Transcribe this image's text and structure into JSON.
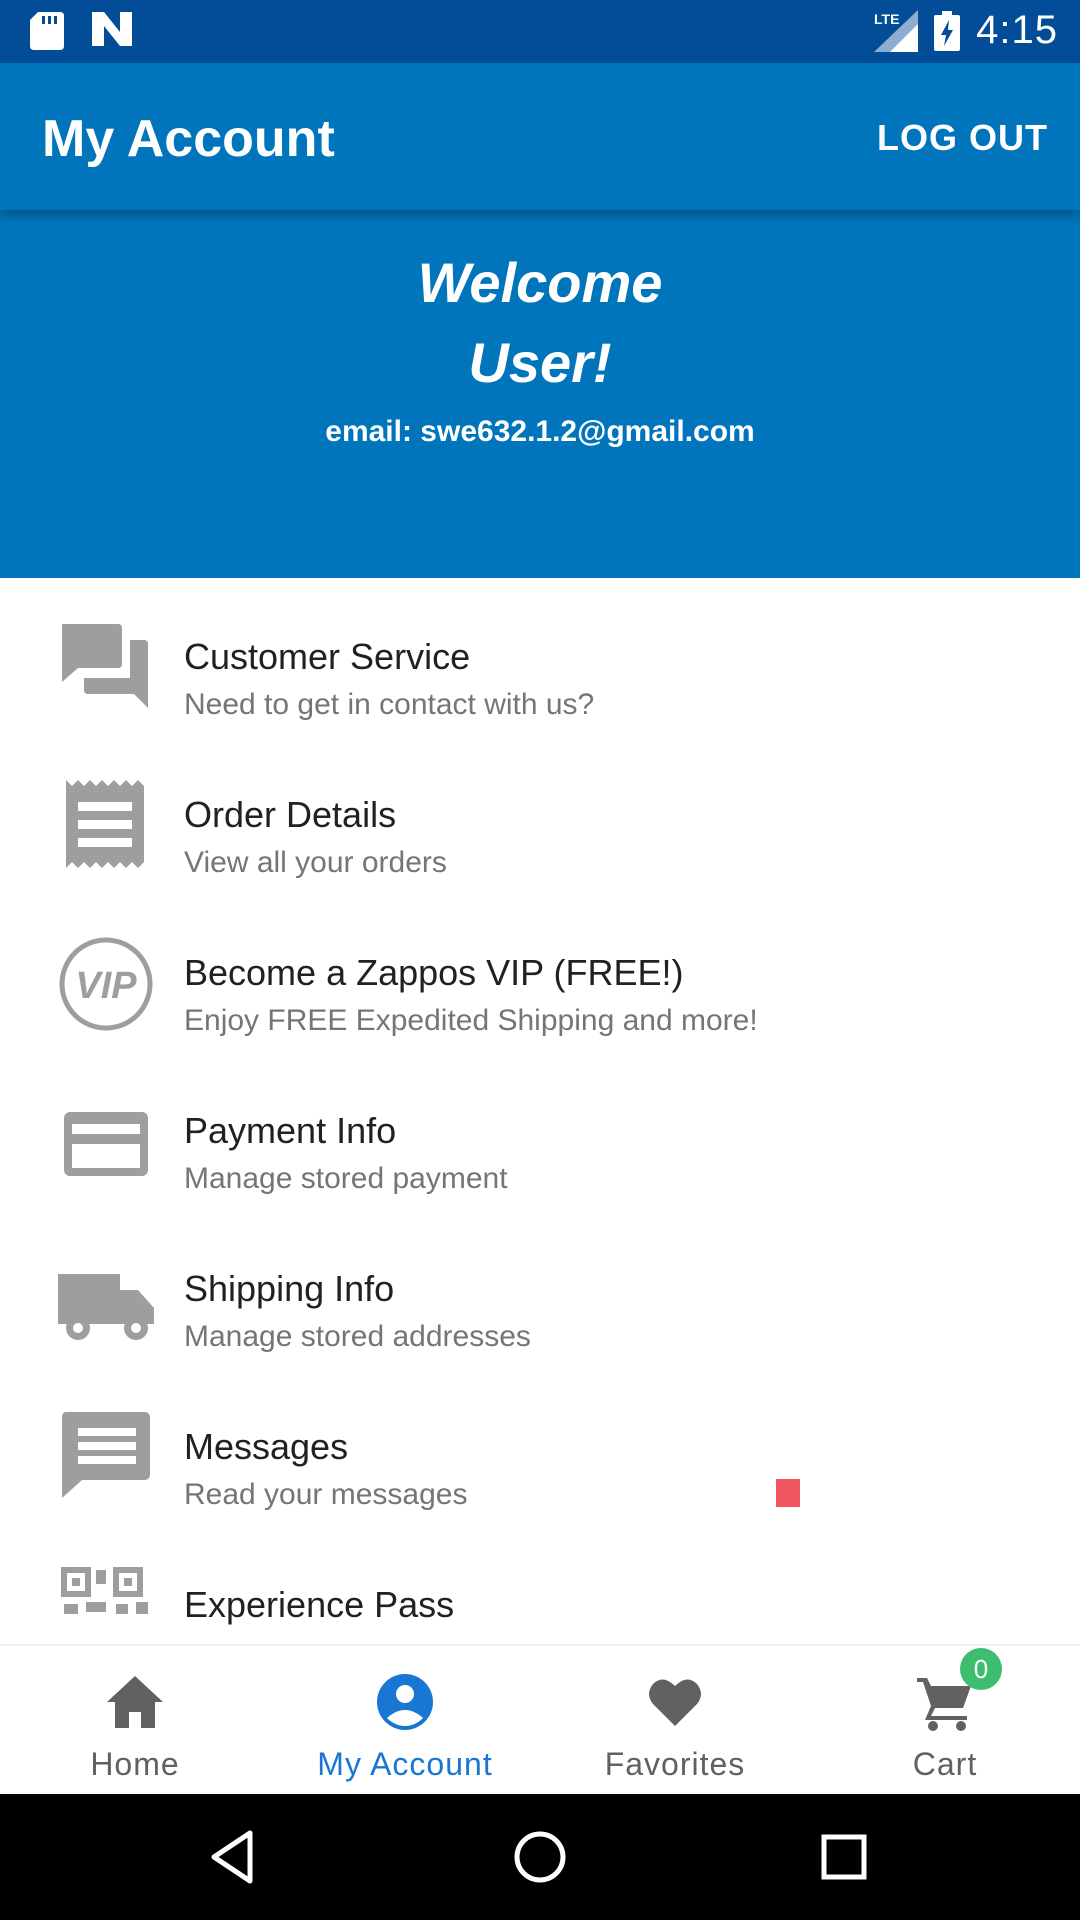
{
  "status_bar": {
    "time": "4:15",
    "network_label": "LTE",
    "icons": [
      "sd-card-icon",
      "n-logo-icon",
      "lte-signal-icon",
      "battery-charging-icon"
    ]
  },
  "app_bar": {
    "title": "My Account",
    "logout_label": "LOG OUT"
  },
  "welcome": {
    "line1": "Welcome",
    "line2": "User!",
    "email": "email: swe632.1.2@gmail.com"
  },
  "menu": {
    "items": [
      {
        "title": "Customer Service",
        "subtitle": "Need to get in contact with us?",
        "icon": "chat-icon"
      },
      {
        "title": "Order Details",
        "subtitle": "View all your orders",
        "icon": "receipt-icon"
      },
      {
        "title": "Become a Zappos VIP (FREE!)",
        "subtitle": "Enjoy FREE Expedited Shipping and more!",
        "icon": "vip-icon"
      },
      {
        "title": "Payment Info",
        "subtitle": "Manage stored payment",
        "icon": "credit-card-icon"
      },
      {
        "title": "Shipping Info",
        "subtitle": "Manage stored addresses",
        "icon": "truck-icon"
      },
      {
        "title": "Messages",
        "subtitle": "Read your messages",
        "icon": "message-icon"
      },
      {
        "title": "Experience Pass",
        "subtitle": "",
        "icon": "qr-code-icon"
      }
    ]
  },
  "bottom_nav": {
    "items": [
      {
        "label": "Home",
        "icon": "home-icon"
      },
      {
        "label": "My Account",
        "icon": "account-icon",
        "active": true
      },
      {
        "label": "Favorites",
        "icon": "heart-icon"
      },
      {
        "label": "Cart",
        "icon": "cart-icon"
      }
    ],
    "cart_count": "0"
  },
  "colors": {
    "status_bar": "#034D98",
    "primary": "#0175BC",
    "active_nav": "#1976D2",
    "badge": "#3DBE6E",
    "icon_gray": "#9E9E9E"
  }
}
